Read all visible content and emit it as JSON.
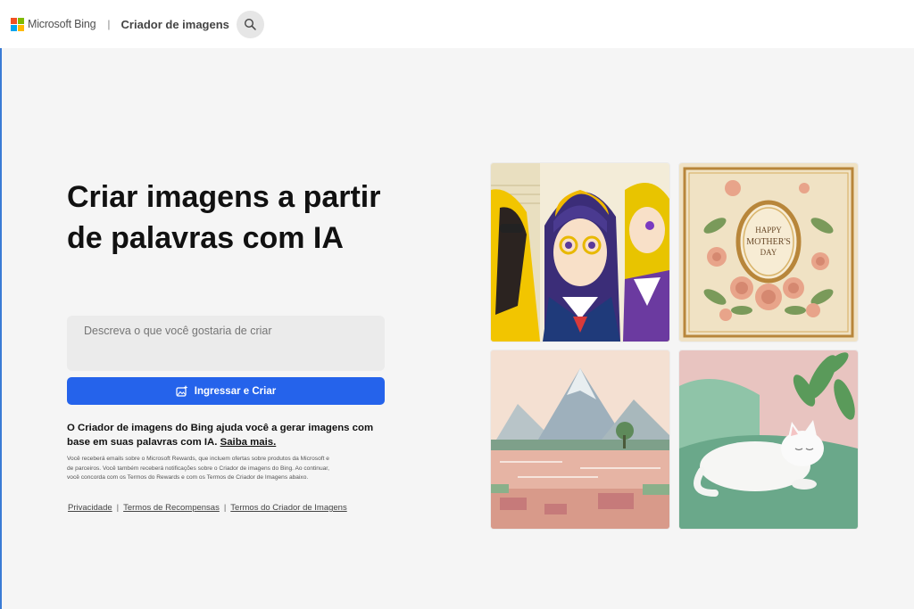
{
  "header": {
    "brand": "Microsoft Bing",
    "separator": "|",
    "app_title": "Criador de imagens",
    "icons": {
      "logo": "microsoft-logo",
      "search": "search-icon"
    }
  },
  "hero": {
    "title": "Criar imagens a partir de palavras com IA",
    "prompt_placeholder": "Descreva o que você gostaria de criar",
    "button_label": "Ingressar e Criar",
    "button_icon": "image-sparkle-icon",
    "description": "O Criador de imagens do Bing ajuda você a gerar imagens com base em suas palavras com IA.",
    "learn_more": "Saiba mais.",
    "fine_print": "Você receberá emails sobre o Microsoft Rewards, que incluem ofertas sobre produtos da Microsoft e de parceiros. Você também receberá notificações sobre o Criador de imagens do Bing. Ao continuar, você concorda com os Termos do Rewards e com os Termos de Criador de Imagens abaixo."
  },
  "footer_links": [
    "Privacidade",
    "Termos de Recompensas",
    "Termos do Criador de Imagens"
  ],
  "gallery": {
    "tiles": [
      {
        "subject": "anime-girls-illustration"
      },
      {
        "subject": "mothers-day-card",
        "text_lines": [
          "HAPPY",
          "MOTHER'S",
          "DAY"
        ]
      },
      {
        "subject": "mountain-lake-painting"
      },
      {
        "subject": "sleeping-white-cat"
      }
    ]
  },
  "colors": {
    "accent": "#2563eb",
    "background": "#f5f5f5",
    "logo": [
      "#f25022",
      "#7fba00",
      "#00a4ef",
      "#ffb900"
    ]
  }
}
